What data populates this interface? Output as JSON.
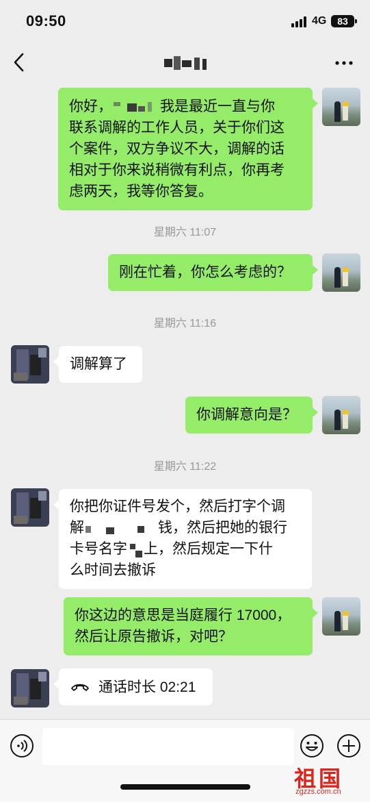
{
  "status_bar": {
    "time": "09:50",
    "network": "4G",
    "battery": "83"
  },
  "header": {
    "back_icon": "chevron-left-icon",
    "title_redacted": true,
    "more_icon": "more-dots-icon"
  },
  "messages": [
    {
      "sender": "me",
      "lines": [
        "你好，[redacted] 我是最近一直与你",
        "联系调解的工作人员，关于你们这",
        "个案件，双方争议不大，调解的话",
        "相对于你来说稍微有利点，你再考",
        "虑两天，我等你答复。"
      ],
      "parts": {
        "l1a": "你好，",
        "l1b": "我是最近一直与你"
      }
    },
    {
      "timestamp": "星期六 11:07"
    },
    {
      "sender": "me",
      "text": "刚在忙着，你怎么考虑的？"
    },
    {
      "timestamp": "星期六 11:16"
    },
    {
      "sender": "other",
      "text": "调解算了"
    },
    {
      "sender": "me",
      "text": "你调解意向是？"
    },
    {
      "timestamp": "星期六 11:22"
    },
    {
      "sender": "other",
      "parts": {
        "l1": "你把你证件号发个，然后打字个调",
        "l2a": "解",
        "l2b": "钱，然后把她的银行",
        "l3a": "卡号名字",
        "l3b": "上，然后规定一下什",
        "l4": "么时间去撤诉"
      }
    },
    {
      "sender": "me",
      "lines": [
        "你这边的意思是当庭履行 17000，",
        "然后让原告撤诉，对吧？"
      ]
    },
    {
      "sender": "other",
      "call_label": "通话时长 02:21",
      "icon": "phone-hangup-icon"
    }
  ],
  "input_bar": {
    "voice_icon": "voice-icon",
    "emoji_icon": "emoji-icon",
    "plus_icon": "plus-icon",
    "placeholder": ""
  },
  "watermark": {
    "text": "祖国",
    "url": "zgzzs.com.cn"
  },
  "colors": {
    "background": "#ededed",
    "my_bubble": "#95ec69",
    "other_bubble": "#ffffff",
    "timestamp": "#999999"
  }
}
